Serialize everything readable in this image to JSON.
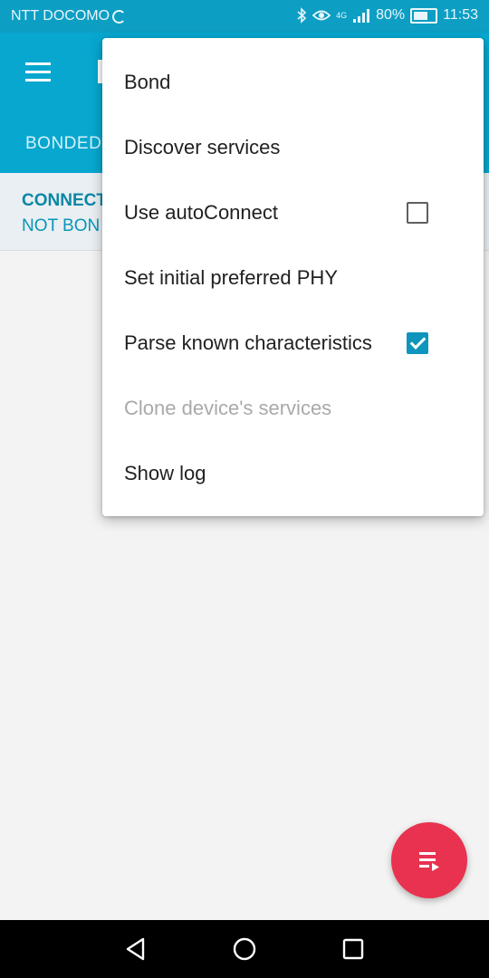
{
  "status_bar": {
    "carrier": "NTT DOCOMO",
    "network": "4G",
    "battery": "80%",
    "time": "11:53",
    "icons": [
      "bluetooth-icon",
      "eye-icon",
      "signal-icon",
      "battery-icon"
    ]
  },
  "app_bar": {
    "tab_label": "BONDED"
  },
  "device_info": {
    "line1": "CONNECT",
    "line2": "NOT BON"
  },
  "menu": {
    "items": [
      {
        "label": "Bond"
      },
      {
        "label": "Discover services"
      },
      {
        "label": "Use autoConnect",
        "checkbox": false
      },
      {
        "label": "Set initial preferred PHY"
      },
      {
        "label": "Parse known characteristics",
        "checkbox": true
      },
      {
        "label": "Clone device's services",
        "disabled": true
      },
      {
        "label": "Show log"
      }
    ]
  },
  "fab": {
    "icon": "log-list-icon"
  },
  "colors": {
    "primary": "#07a7cf",
    "status_bar": "#0d9ec4",
    "accent": "#e8324f",
    "checkbox_checked": "#0d95bd"
  }
}
